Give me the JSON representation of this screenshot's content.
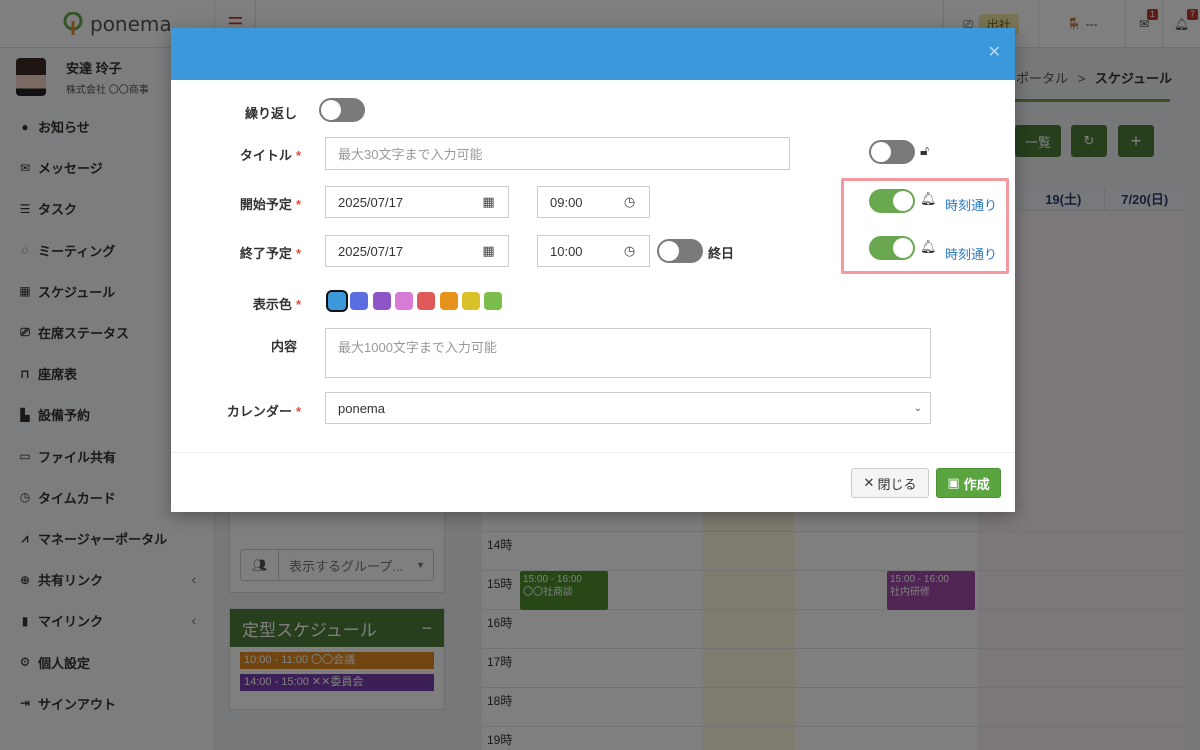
{
  "app": {
    "name": "ponema"
  },
  "header": {
    "attendance_status": "出社",
    "seat_status": "---",
    "message_badge": "1",
    "notification_badge": "7"
  },
  "user": {
    "name": "安達 玲子",
    "company": "株式会社 〇〇商事"
  },
  "sidebar": {
    "items": [
      {
        "label": "お知らせ",
        "icon": "info-icon"
      },
      {
        "label": "メッセージ",
        "icon": "envelope-icon"
      },
      {
        "label": "タスク",
        "icon": "tasks-icon"
      },
      {
        "label": "ミーティング",
        "icon": "comments-icon"
      },
      {
        "label": "スケジュール",
        "icon": "calendar-icon"
      },
      {
        "label": "在席ステータス",
        "icon": "status-icon"
      },
      {
        "label": "座席表",
        "icon": "chair-icon"
      },
      {
        "label": "設備予約",
        "icon": "building-icon"
      },
      {
        "label": "ファイル共有",
        "icon": "folder-icon"
      },
      {
        "label": "タイムカード",
        "icon": "clock-icon"
      },
      {
        "label": "マネージャーポータル",
        "icon": "chart-icon"
      },
      {
        "label": "共有リンク",
        "icon": "globe-icon",
        "chevron": true
      },
      {
        "label": "マイリンク",
        "icon": "bookmark-icon",
        "chevron": true
      },
      {
        "label": "個人設定",
        "icon": "gear-icon"
      },
      {
        "label": "サインアウト",
        "icon": "sign-out-icon"
      }
    ]
  },
  "breadcrumb": {
    "parent": "ポータル",
    "separator": ">",
    "current": "スケジュール"
  },
  "toolbar": {
    "list_label": "一覧"
  },
  "calendar": {
    "day_headers": [
      "19(土)",
      "7/20(日)"
    ],
    "hours": [
      "14時",
      "15時",
      "16時",
      "17時",
      "18時",
      "19時"
    ],
    "events": [
      {
        "time": "15:00 - 16:00",
        "title": "〇〇社商談",
        "color": "#4e8f2e"
      },
      {
        "time": "15:00 - 16:00",
        "title": "社内研修",
        "color": "#a04aa8"
      }
    ]
  },
  "group_filter": {
    "placeholder": "表示するグループ..."
  },
  "fixed_schedule": {
    "title": "定型スケジュール",
    "items": [
      {
        "label": "10:00 - 11:00  〇〇会議",
        "color": "#e08a1e"
      },
      {
        "label": "14:00 - 15:00  ✕✕委員会",
        "color": "#7b3fb0"
      }
    ]
  },
  "modal": {
    "repeat_label": "繰り返し",
    "title_label": "タイトル",
    "title_placeholder": "最大30文字まで入力可能",
    "start_label": "開始予定",
    "start_date": "2025/07/17",
    "start_time": "09:00",
    "end_label": "終了予定",
    "end_date": "2025/07/17",
    "end_time": "10:00",
    "allday_label": "終日",
    "start_reminder_link": "時刻通り",
    "end_reminder_link": "時刻通り",
    "color_label": "表示色",
    "colors": [
      "#3a98db",
      "#5b6ee1",
      "#8e55c9",
      "#d77bd6",
      "#e05a5a",
      "#e8921e",
      "#d9c12a",
      "#7bbd4a"
    ],
    "selected_color_index": 0,
    "content_label": "内容",
    "content_placeholder": "最大1000文字まで入力可能",
    "calendar_label": "カレンダー",
    "calendar_value": "ponema",
    "close_button": "閉じる",
    "create_button": "作成",
    "required_mark": "*"
  }
}
